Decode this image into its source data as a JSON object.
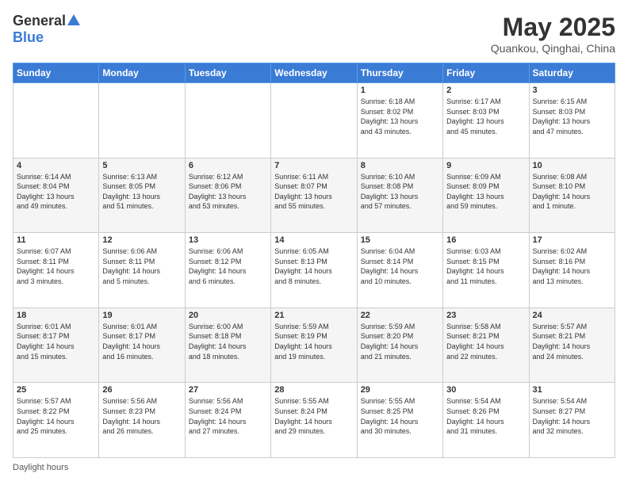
{
  "logo": {
    "general": "General",
    "blue": "Blue"
  },
  "title": "May 2025",
  "location": "Quankou, Qinghai, China",
  "days_header": [
    "Sunday",
    "Monday",
    "Tuesday",
    "Wednesday",
    "Thursday",
    "Friday",
    "Saturday"
  ],
  "footer": "Daylight hours",
  "weeks": [
    [
      {
        "day": "",
        "info": ""
      },
      {
        "day": "",
        "info": ""
      },
      {
        "day": "",
        "info": ""
      },
      {
        "day": "",
        "info": ""
      },
      {
        "day": "1",
        "info": "Sunrise: 6:18 AM\nSunset: 8:02 PM\nDaylight: 13 hours\nand 43 minutes."
      },
      {
        "day": "2",
        "info": "Sunrise: 6:17 AM\nSunset: 8:03 PM\nDaylight: 13 hours\nand 45 minutes."
      },
      {
        "day": "3",
        "info": "Sunrise: 6:15 AM\nSunset: 8:03 PM\nDaylight: 13 hours\nand 47 minutes."
      }
    ],
    [
      {
        "day": "4",
        "info": "Sunrise: 6:14 AM\nSunset: 8:04 PM\nDaylight: 13 hours\nand 49 minutes."
      },
      {
        "day": "5",
        "info": "Sunrise: 6:13 AM\nSunset: 8:05 PM\nDaylight: 13 hours\nand 51 minutes."
      },
      {
        "day": "6",
        "info": "Sunrise: 6:12 AM\nSunset: 8:06 PM\nDaylight: 13 hours\nand 53 minutes."
      },
      {
        "day": "7",
        "info": "Sunrise: 6:11 AM\nSunset: 8:07 PM\nDaylight: 13 hours\nand 55 minutes."
      },
      {
        "day": "8",
        "info": "Sunrise: 6:10 AM\nSunset: 8:08 PM\nDaylight: 13 hours\nand 57 minutes."
      },
      {
        "day": "9",
        "info": "Sunrise: 6:09 AM\nSunset: 8:09 PM\nDaylight: 13 hours\nand 59 minutes."
      },
      {
        "day": "10",
        "info": "Sunrise: 6:08 AM\nSunset: 8:10 PM\nDaylight: 14 hours\nand 1 minute."
      }
    ],
    [
      {
        "day": "11",
        "info": "Sunrise: 6:07 AM\nSunset: 8:11 PM\nDaylight: 14 hours\nand 3 minutes."
      },
      {
        "day": "12",
        "info": "Sunrise: 6:06 AM\nSunset: 8:11 PM\nDaylight: 14 hours\nand 5 minutes."
      },
      {
        "day": "13",
        "info": "Sunrise: 6:06 AM\nSunset: 8:12 PM\nDaylight: 14 hours\nand 6 minutes."
      },
      {
        "day": "14",
        "info": "Sunrise: 6:05 AM\nSunset: 8:13 PM\nDaylight: 14 hours\nand 8 minutes."
      },
      {
        "day": "15",
        "info": "Sunrise: 6:04 AM\nSunset: 8:14 PM\nDaylight: 14 hours\nand 10 minutes."
      },
      {
        "day": "16",
        "info": "Sunrise: 6:03 AM\nSunset: 8:15 PM\nDaylight: 14 hours\nand 11 minutes."
      },
      {
        "day": "17",
        "info": "Sunrise: 6:02 AM\nSunset: 8:16 PM\nDaylight: 14 hours\nand 13 minutes."
      }
    ],
    [
      {
        "day": "18",
        "info": "Sunrise: 6:01 AM\nSunset: 8:17 PM\nDaylight: 14 hours\nand 15 minutes."
      },
      {
        "day": "19",
        "info": "Sunrise: 6:01 AM\nSunset: 8:17 PM\nDaylight: 14 hours\nand 16 minutes."
      },
      {
        "day": "20",
        "info": "Sunrise: 6:00 AM\nSunset: 8:18 PM\nDaylight: 14 hours\nand 18 minutes."
      },
      {
        "day": "21",
        "info": "Sunrise: 5:59 AM\nSunset: 8:19 PM\nDaylight: 14 hours\nand 19 minutes."
      },
      {
        "day": "22",
        "info": "Sunrise: 5:59 AM\nSunset: 8:20 PM\nDaylight: 14 hours\nand 21 minutes."
      },
      {
        "day": "23",
        "info": "Sunrise: 5:58 AM\nSunset: 8:21 PM\nDaylight: 14 hours\nand 22 minutes."
      },
      {
        "day": "24",
        "info": "Sunrise: 5:57 AM\nSunset: 8:21 PM\nDaylight: 14 hours\nand 24 minutes."
      }
    ],
    [
      {
        "day": "25",
        "info": "Sunrise: 5:57 AM\nSunset: 8:22 PM\nDaylight: 14 hours\nand 25 minutes."
      },
      {
        "day": "26",
        "info": "Sunrise: 5:56 AM\nSunset: 8:23 PM\nDaylight: 14 hours\nand 26 minutes."
      },
      {
        "day": "27",
        "info": "Sunrise: 5:56 AM\nSunset: 8:24 PM\nDaylight: 14 hours\nand 27 minutes."
      },
      {
        "day": "28",
        "info": "Sunrise: 5:55 AM\nSunset: 8:24 PM\nDaylight: 14 hours\nand 29 minutes."
      },
      {
        "day": "29",
        "info": "Sunrise: 5:55 AM\nSunset: 8:25 PM\nDaylight: 14 hours\nand 30 minutes."
      },
      {
        "day": "30",
        "info": "Sunrise: 5:54 AM\nSunset: 8:26 PM\nDaylight: 14 hours\nand 31 minutes."
      },
      {
        "day": "31",
        "info": "Sunrise: 5:54 AM\nSunset: 8:27 PM\nDaylight: 14 hours\nand 32 minutes."
      }
    ]
  ]
}
